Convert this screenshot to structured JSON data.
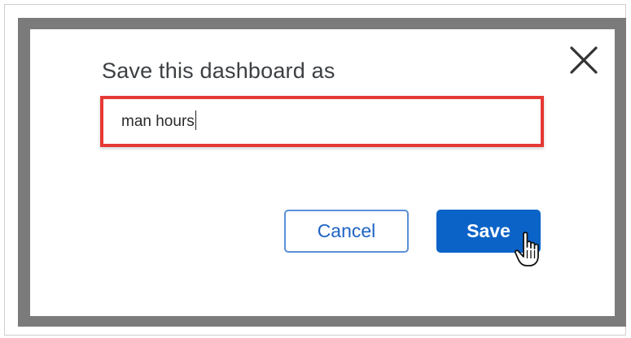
{
  "dialog": {
    "title": "Save this dashboard as",
    "name_field": {
      "value": "man hours"
    },
    "cancel_label": "Cancel",
    "save_label": "Save",
    "close_icon": "close-icon",
    "cursor_icon": "hand-pointer-cursor-icon"
  },
  "colors": {
    "highlight_border": "#e53935",
    "primary_button": "#0b63c8",
    "secondary_button_border": "#5b8fd6",
    "secondary_button_text": "#1e63c4",
    "overlay": "#7b7b7b"
  }
}
